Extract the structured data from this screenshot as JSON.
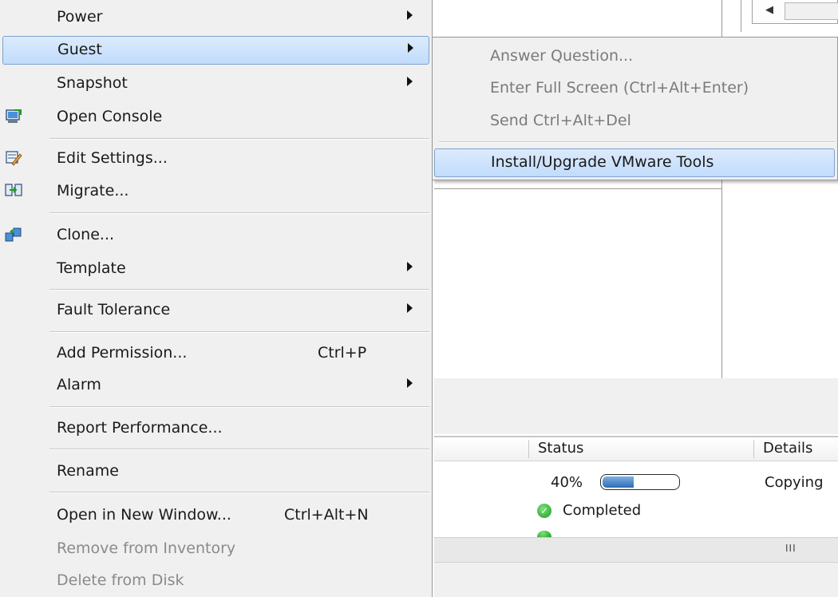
{
  "context_menu": {
    "items": [
      {
        "label": "Power",
        "has_submenu": true
      },
      {
        "label": "Guest",
        "has_submenu": true,
        "highlighted": true
      },
      {
        "label": "Snapshot",
        "has_submenu": true
      },
      {
        "label": "Open Console",
        "icon": "console-icon"
      },
      {
        "label": "Edit Settings...",
        "icon": "edit-settings-icon"
      },
      {
        "label": "Migrate...",
        "icon": "migrate-icon"
      },
      {
        "label": "Clone...",
        "icon": "clone-icon"
      },
      {
        "label": "Template",
        "has_submenu": true
      },
      {
        "label": "Fault Tolerance",
        "has_submenu": true
      },
      {
        "label": "Add Permission...",
        "shortcut": "Ctrl+P"
      },
      {
        "label": "Alarm",
        "has_submenu": true
      },
      {
        "label": "Report Performance..."
      },
      {
        "label": "Rename"
      },
      {
        "label": "Open in New Window...",
        "shortcut": "Ctrl+Alt+N"
      },
      {
        "label": "Remove from Inventory",
        "disabled": true
      },
      {
        "label": "Delete from Disk",
        "disabled": true
      }
    ]
  },
  "guest_submenu": {
    "items": [
      {
        "label": "Answer Question...",
        "disabled": true
      },
      {
        "label": "Enter Full Screen (Ctrl+Alt+Enter)",
        "disabled": true
      },
      {
        "label": "Send Ctrl+Alt+Del",
        "disabled": true
      },
      {
        "label": "Install/Upgrade VMware Tools",
        "highlighted": true
      }
    ]
  },
  "tasks_table": {
    "columns": [
      "Status",
      "Details"
    ],
    "rows": [
      {
        "status_text": "40%",
        "progress_fraction": 0.4,
        "details": "Copying"
      },
      {
        "status_text": "Completed",
        "status_icon": "check-icon",
        "details": ""
      }
    ]
  },
  "colors": {
    "menu_bg": "#f0f0f0",
    "highlight_top": "#dcebfc",
    "highlight_bottom": "#c1dcfc",
    "highlight_border": "#7da2ce",
    "disabled_text": "#8a8a8a",
    "success": "#19a019"
  }
}
